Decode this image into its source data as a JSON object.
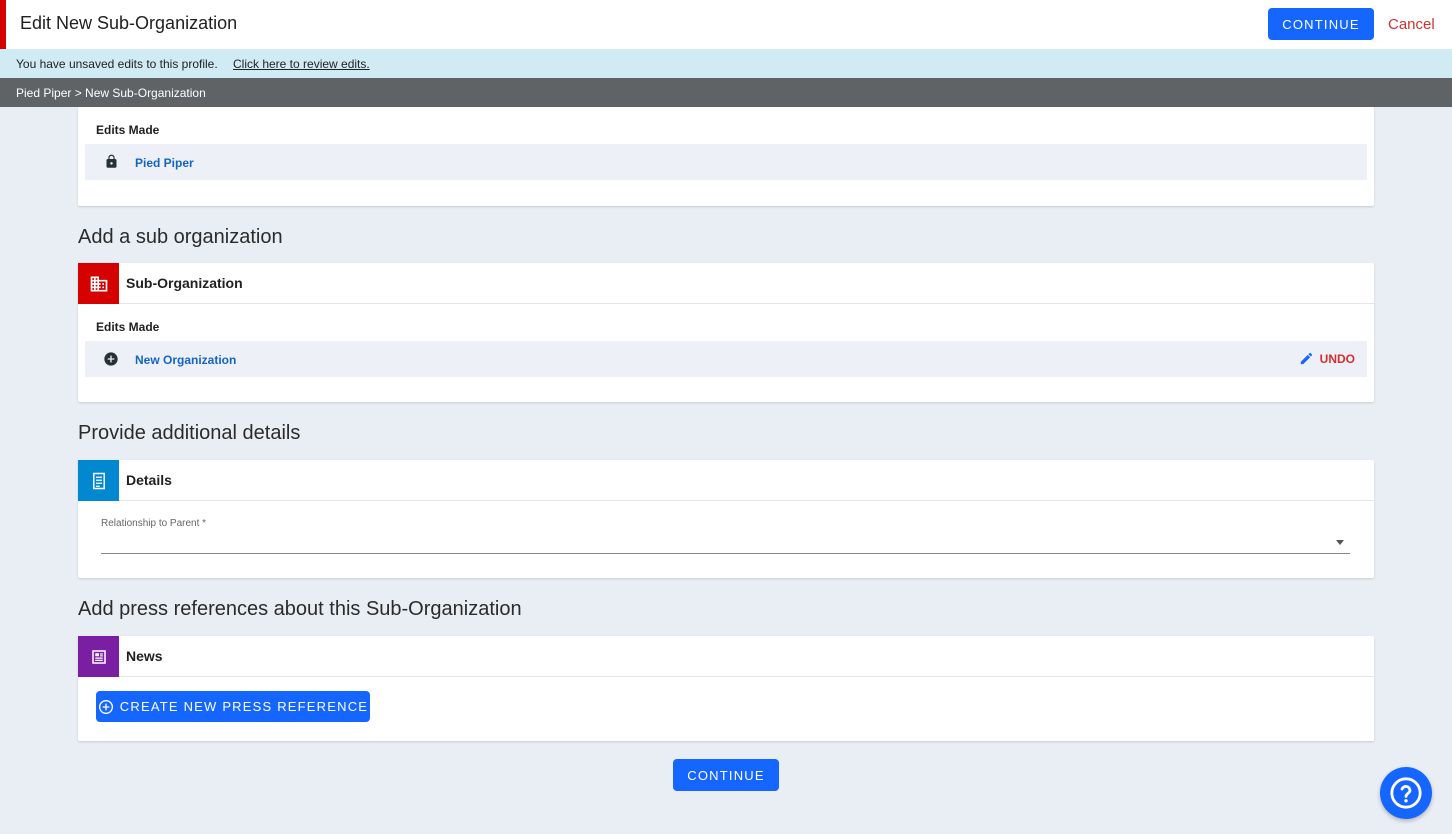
{
  "header": {
    "title": "Edit New Sub-Organization",
    "continue_label": "CONTINUE",
    "cancel_label": "Cancel"
  },
  "banner": {
    "message": "You have unsaved edits to this profile.",
    "link_text": "Click here to review edits."
  },
  "breadcrumb": "Pied Piper > New Sub-Organization",
  "parent_card": {
    "edits_label": "Edits Made",
    "item_label": "Pied Piper",
    "item_icon": "lock-icon"
  },
  "sections": {
    "sub_org": "Add a sub organization",
    "details": "Provide additional details",
    "press": "Add press references about this Sub-Organization"
  },
  "sub_org_card": {
    "title": "Sub-Organization",
    "edits_label": "Edits Made",
    "item_label": "New Organization",
    "undo_label": "UNDO",
    "color": "#d50000"
  },
  "details_card": {
    "title": "Details",
    "field_label": "Relationship to Parent *",
    "field_value": "",
    "color": "#0288d1"
  },
  "news_card": {
    "title": "News",
    "create_label": "CREATE NEW PRESS REFERENCE",
    "color": "#7b1fa2"
  },
  "footer": {
    "continue_label": "CONTINUE"
  },
  "accent_color": "#1565ff"
}
